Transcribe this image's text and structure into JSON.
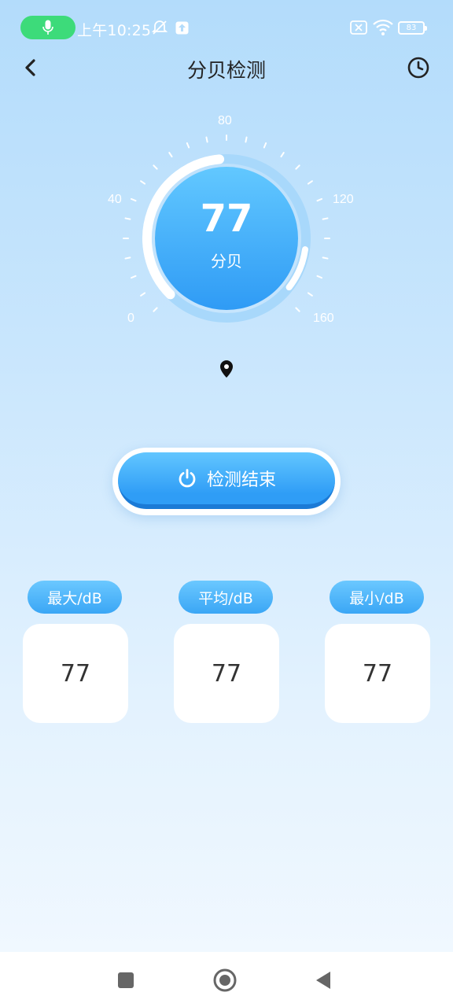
{
  "status_bar": {
    "time": "上午10:25",
    "battery": "83",
    "icons": [
      "microphone-icon",
      "mute-bell-icon",
      "upload-icon",
      "no-sim-icon",
      "wifi-icon",
      "battery-icon"
    ]
  },
  "header": {
    "title": "分贝检测",
    "back_icon": "chevron-left-icon",
    "history_icon": "clock-icon"
  },
  "gauge": {
    "value": "77",
    "unit": "分贝",
    "scale_labels": [
      "0",
      "40",
      "80",
      "120",
      "160"
    ],
    "scale_min": 0,
    "scale_max": 160,
    "current_db": 77,
    "colors": {
      "progress": "#a8d8fb",
      "inner_top": "#62c8ff",
      "inner_bottom": "#2f9bf5"
    }
  },
  "location_icon": "location-pin-icon",
  "stop_button": {
    "label": "检测结束",
    "icon": "power-icon"
  },
  "stats": [
    {
      "label": "最大/dB",
      "value": "77"
    },
    {
      "label": "平均/dB",
      "value": "77"
    },
    {
      "label": "最小/dB",
      "value": "77"
    }
  ],
  "nav_bar": {
    "icons": [
      "square-icon",
      "home-circle-icon",
      "back-triangle-icon"
    ]
  }
}
